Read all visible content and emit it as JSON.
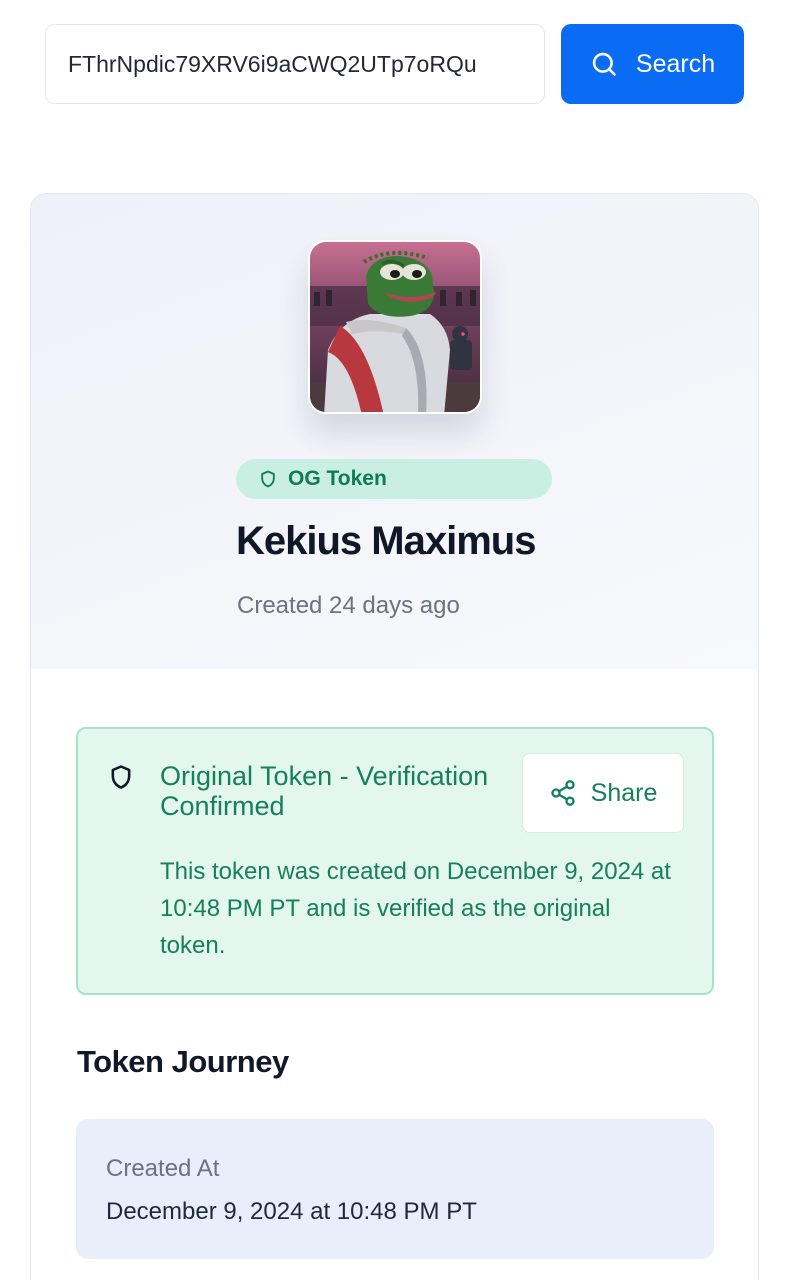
{
  "search": {
    "value": "FThrNpdic79XRV6i9aCWQ2UTp7oRQu",
    "button_label": "Search"
  },
  "token": {
    "badge": "OG Token",
    "name": "Kekius Maximus",
    "created_ago": "Created 24 days ago",
    "image_icon": "pepe-roman-avatar"
  },
  "verification": {
    "title": "Original Token - Verification Confirmed",
    "share_label": "Share",
    "message": "This token was created on December 9, 2024 at 10:48 PM PT and is verified as the original token."
  },
  "journey": {
    "title": "Token Journey",
    "entries": [
      {
        "label": "Created At",
        "value": "December 9, 2024 at 10:48 PM PT"
      }
    ]
  },
  "colors": {
    "primary": "#0a6cf5",
    "success": "#15805a",
    "success_bg": "#e3f7ee",
    "badge_bg": "#c9efe3"
  }
}
